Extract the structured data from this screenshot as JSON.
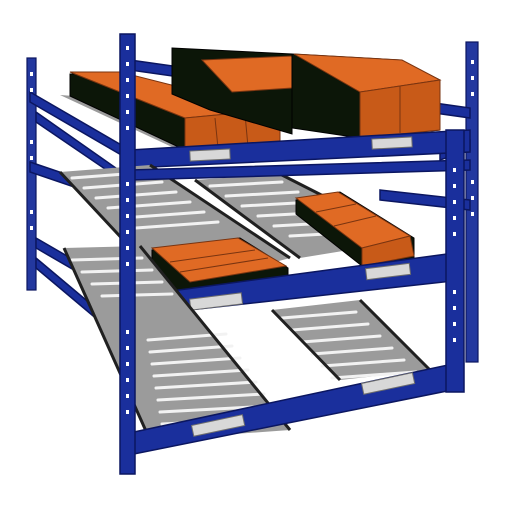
{
  "image": {
    "subject": "",
    "colors": {
      "frame": "#1a2f9c",
      "boxes": "#e06a24",
      "rollers": "#f2f2f2",
      "label_plates": "#d8d8d8",
      "background": "#ffffff"
    }
  }
}
